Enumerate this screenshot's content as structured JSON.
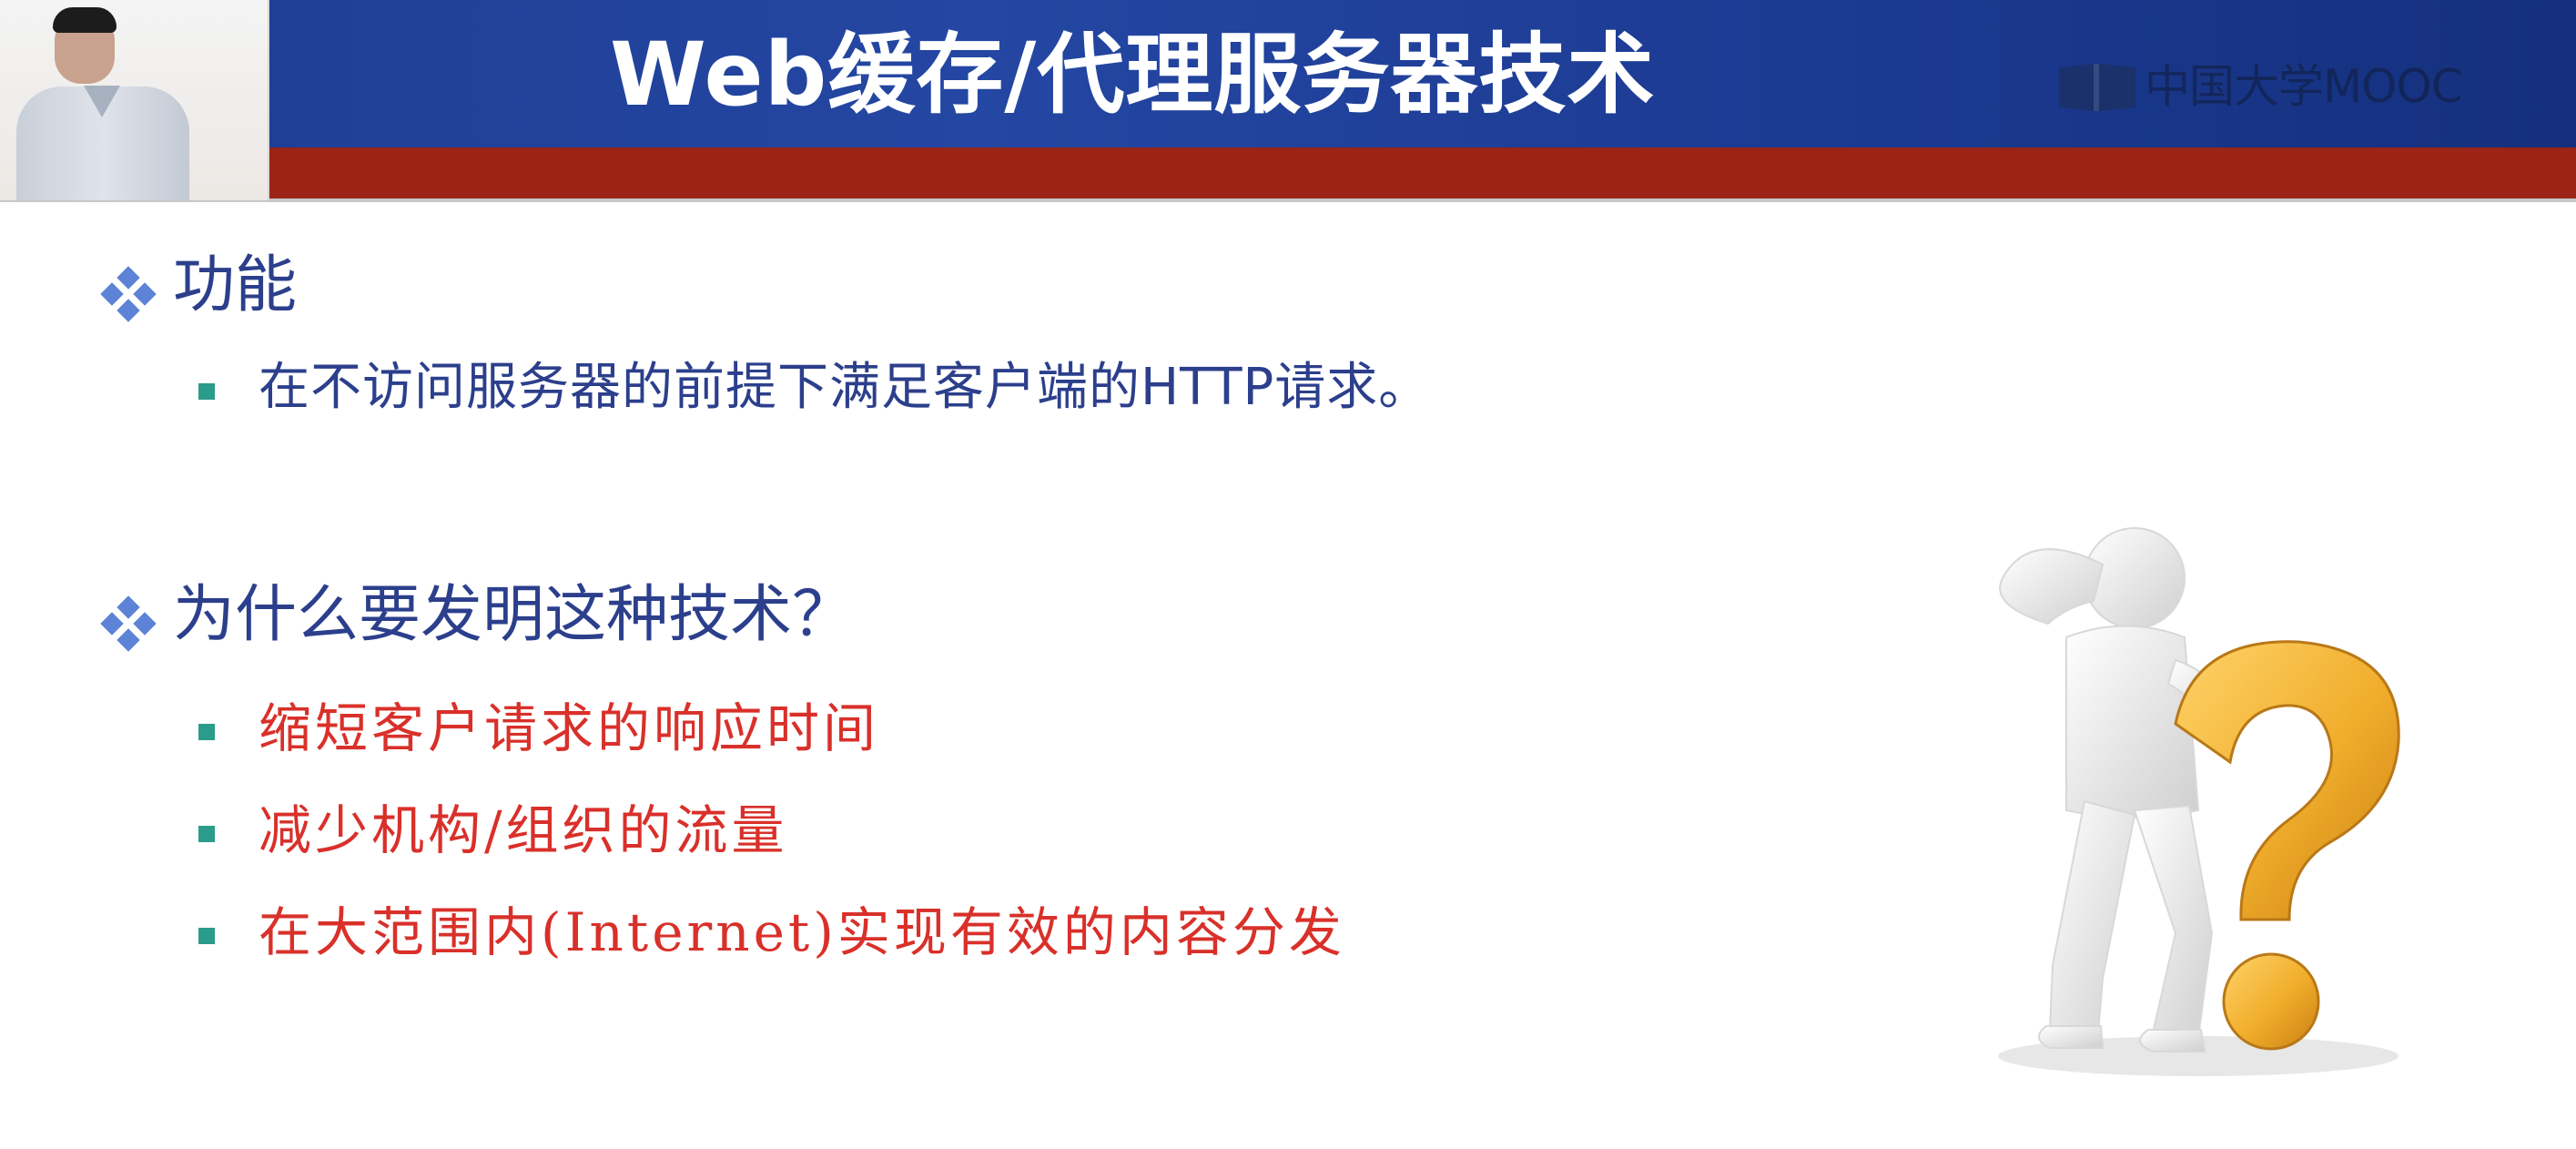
{
  "header": {
    "title": "Web缓存/代理服务器技术",
    "brand": "中国大学MOOC",
    "brand_icon": "mooc-book-icon"
  },
  "sections": [
    {
      "heading": "功能",
      "bullets": [
        "在不访问服务器的前提下满足客户端的HTTP请求。"
      ]
    },
    {
      "heading": "为什么要发明这种技术？",
      "bullets": [
        "缩短客户请求的响应时间",
        "减少机构/组织的流量",
        "在大范围内(Internet)实现有效的内容分发"
      ]
    }
  ],
  "icons": {
    "section_marker": "diamond-bullet-icon",
    "bullet_marker": "square-bullet-icon",
    "illustration": "thinking-figure-question-mark-icon"
  },
  "colors": {
    "header_blue": "#2447a3",
    "header_red": "#9b2416",
    "heading_blue": "#2c3f8c",
    "emphasis_red": "#d9302a",
    "bullet_teal": "#2b9c8a",
    "question_gold": "#f0ad2b"
  }
}
